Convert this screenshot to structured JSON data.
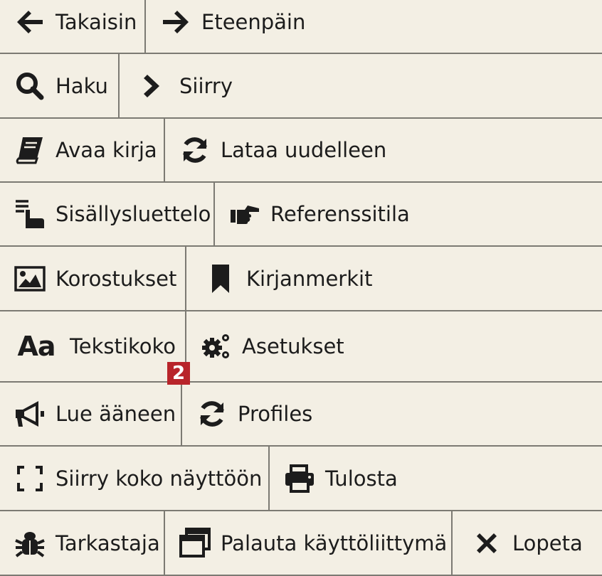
{
  "toolbar": {
    "back": "Takaisin",
    "forward": "Eteenpäin",
    "search": "Haku",
    "goto": "Siirry",
    "open_book": "Avaa kirja",
    "reload": "Lataa uudelleen",
    "toc": "Sisällysluettelo",
    "reference_mode": "Referenssitila",
    "highlights": "Korostukset",
    "bookmarks": "Kirjanmerkit",
    "text_size": "Tekstikoko",
    "text_size_glyph": "Aa",
    "settings": "Asetukset",
    "read_aloud": "Lue ääneen",
    "profiles": "Profiles",
    "fullscreen": "Siirry koko näyttöön",
    "print": "Tulosta",
    "inspector": "Tarkastaja",
    "reset_ui": "Palauta käyttöliittymä",
    "quit": "Lopeta"
  },
  "callout_badge": "2",
  "colors": {
    "background": "#f3efe4",
    "border": "#7c7a73",
    "icon": "#1c1c1c",
    "badge": "#b8242a"
  }
}
